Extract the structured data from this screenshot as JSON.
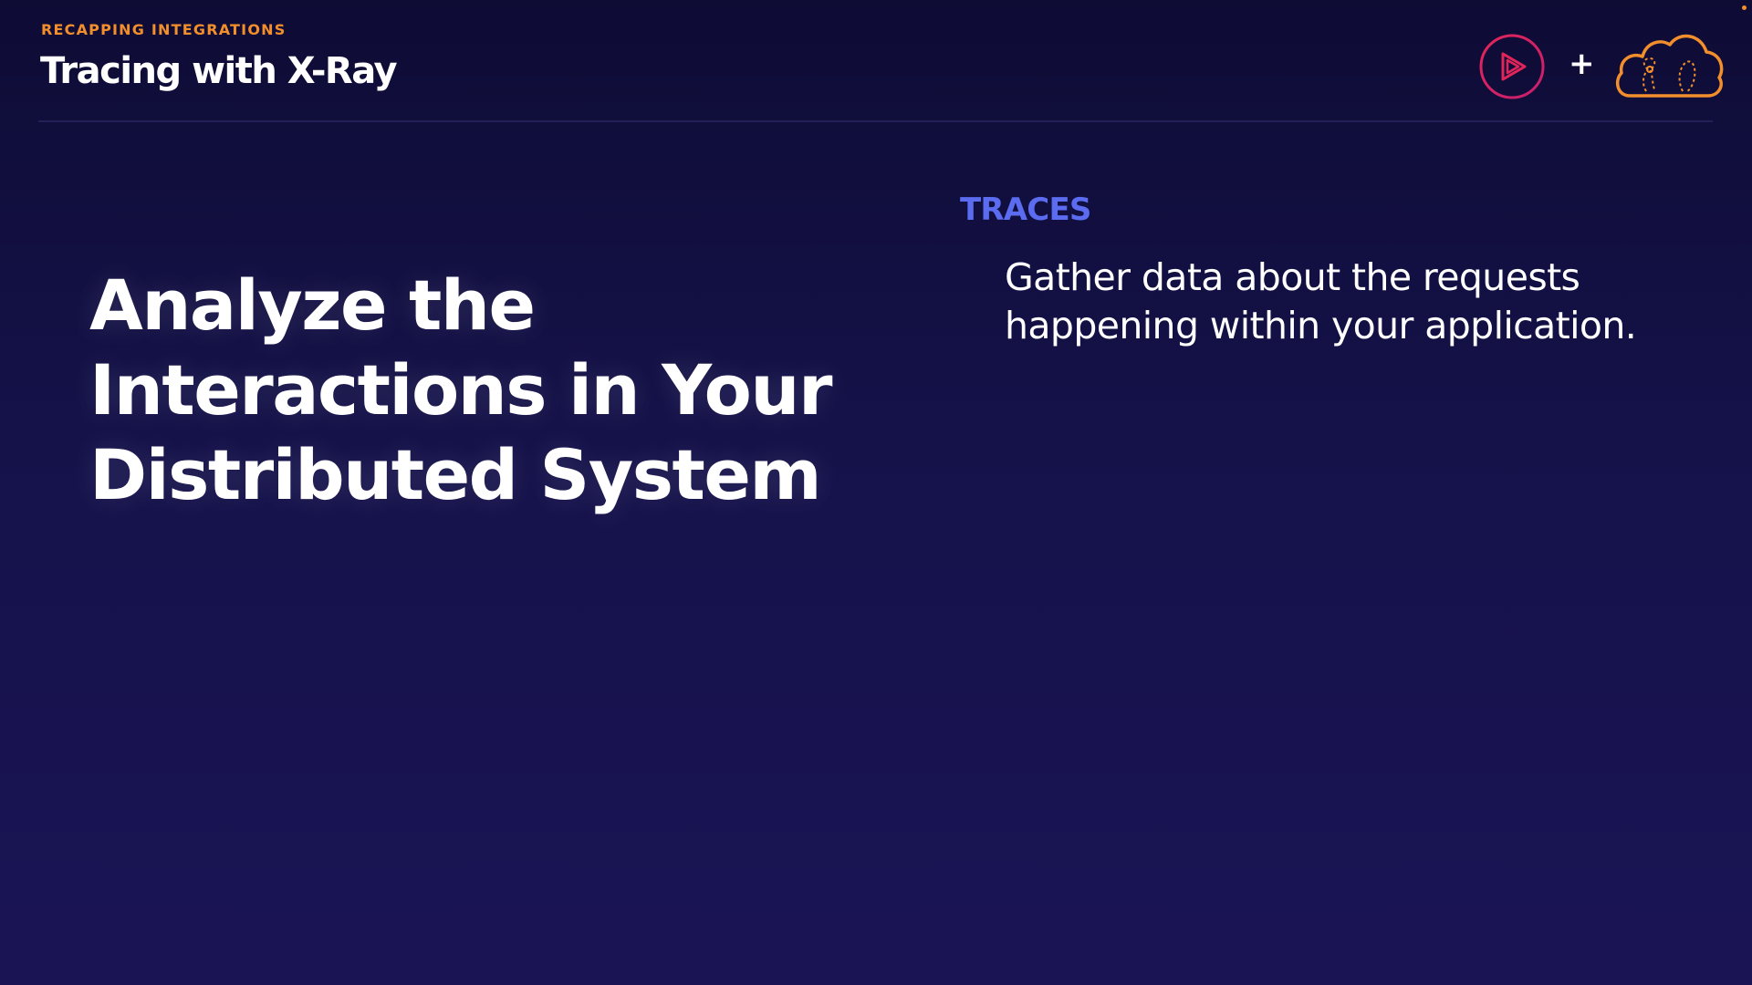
{
  "header": {
    "eyebrow": "RECAPPING INTEGRATIONS",
    "title": "Tracing with X-Ray",
    "plus": "+"
  },
  "logos": {
    "left_icon": "play-icon",
    "right_icon": "cloud-icon",
    "play_color": "#e0255a",
    "cloud_color": "#f28f2c"
  },
  "main": {
    "headline_lines": [
      "Analyze the",
      "Interactions in Your",
      "Distributed System"
    ],
    "section_label": "TRACES",
    "description_lines": [
      "Gather data about the requests",
      "happening within your application."
    ]
  },
  "colors": {
    "background_top": "#0e0c35",
    "background_bottom": "#1a1455",
    "accent_orange": "#f28f2c",
    "accent_blue": "#5b6cf0",
    "text": "#ffffff"
  }
}
